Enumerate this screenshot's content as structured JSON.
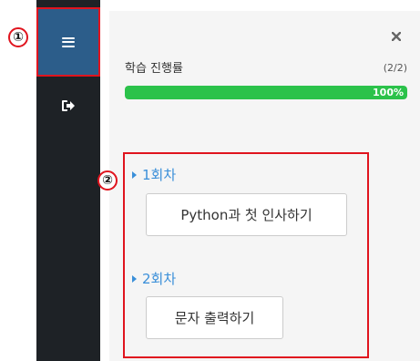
{
  "markers": {
    "one": "①",
    "two": "②"
  },
  "sidebar": {
    "menu_icon": "hamburger-menu-icon",
    "exit_icon": "sign-out-icon"
  },
  "panel": {
    "close_label": "✖",
    "progress": {
      "label": "학습 진행률",
      "count": "(2/2)",
      "percent_text": "100%",
      "percent": 100
    },
    "sessions": [
      {
        "title": "1회차",
        "lesson": "Python과 첫 인사하기"
      },
      {
        "title": "2회차",
        "lesson": "문자 출력하기"
      }
    ]
  },
  "colors": {
    "sidebar": "#1e2226",
    "menu_active": "#2c5d8a",
    "progress_fill": "#2bc24a",
    "session_title": "#3a8fd9",
    "annotation": "#e0141e"
  }
}
